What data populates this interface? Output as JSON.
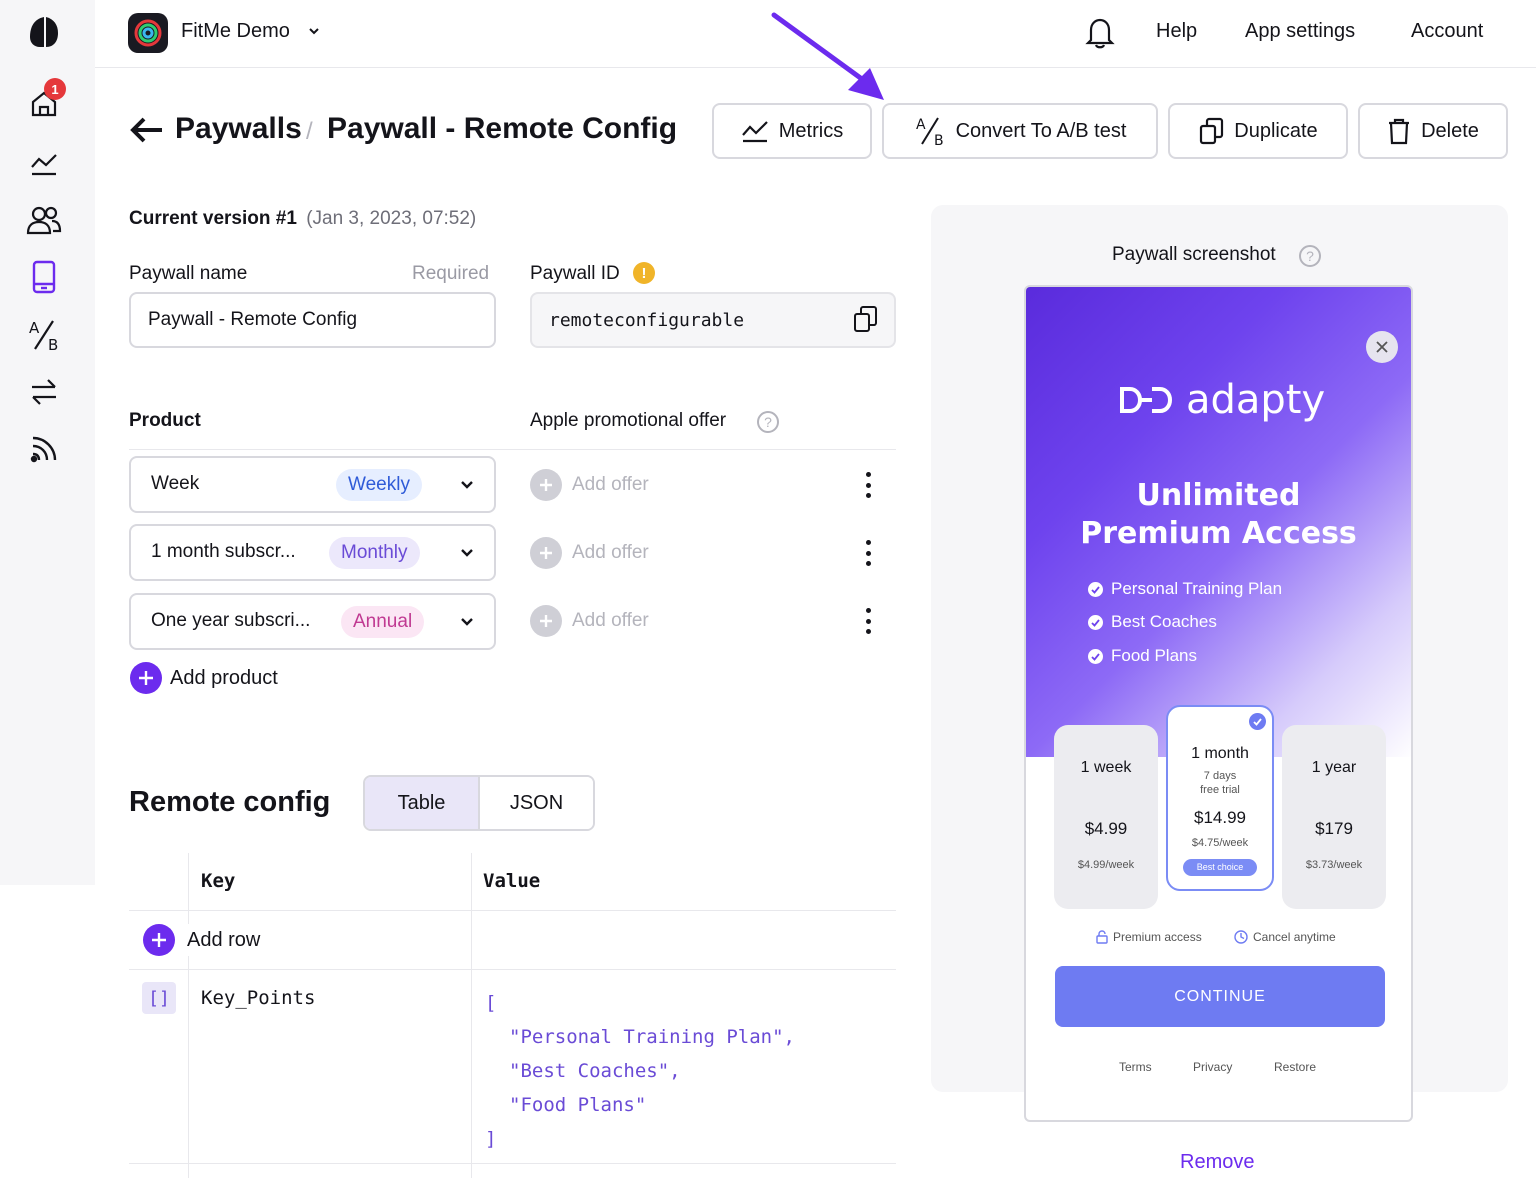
{
  "topbar": {
    "app_name": "FitMe Demo",
    "help": "Help",
    "app_settings": "App settings",
    "account": "Account"
  },
  "sidebar": {
    "home_badge": "1"
  },
  "header": {
    "crumb_parent": "Paywalls",
    "crumb_sep": "/",
    "crumb_current": "Paywall - Remote Config",
    "metrics": "Metrics",
    "convert": "Convert To A/B test",
    "duplicate": "Duplicate",
    "delete": "Delete"
  },
  "version": {
    "label": "Current version #1",
    "date": "(Jan 3, 2023, 07:52)"
  },
  "form": {
    "name_label": "Paywall name",
    "name_required": "Required",
    "name_value": "Paywall - Remote Config",
    "id_label": "Paywall ID",
    "id_value": "remoteconfigurable"
  },
  "products": {
    "product_header": "Product",
    "offer_header": "Apple promotional offer",
    "rows": [
      {
        "name": "Week",
        "period": "Weekly",
        "offer": "Add offer"
      },
      {
        "name": "1 month subscr...",
        "period": "Monthly",
        "offer": "Add offer"
      },
      {
        "name": "One year subscri...",
        "period": "Annual",
        "offer": "Add offer"
      }
    ],
    "add_product": "Add product"
  },
  "remote_config": {
    "title": "Remote config",
    "tab_table": "Table",
    "tab_json": "JSON",
    "col_key": "Key",
    "col_value": "Value",
    "add_row": "Add row",
    "row_type_badge": "[]",
    "row_key": "Key_Points",
    "value_lines": [
      "[",
      "\"Personal Training Plan\",",
      "\"Best Coaches\",",
      "\"Food Plans\"",
      "]"
    ]
  },
  "preview": {
    "title": "Paywall screenshot",
    "remove": "Remove",
    "brand": "adapty",
    "headline_1": "Unlimited",
    "headline_2": "Premium Access",
    "features": [
      "Personal Training Plan",
      "Best Coaches",
      "Food Plans"
    ],
    "plans": [
      {
        "title": "1 week",
        "price": "$4.99",
        "per": "$4.99/week"
      },
      {
        "title": "1 month",
        "trial_1": "7 days",
        "trial_2": "free trial",
        "price": "$14.99",
        "per": "$4.75/week",
        "badge": "Best choice"
      },
      {
        "title": "1 year",
        "price": "$179",
        "per": "$3.73/week"
      }
    ],
    "premium_access": "Premium access",
    "cancel_anytime": "Cancel anytime",
    "continue": "CONTINUE",
    "terms": "Terms",
    "privacy": "Privacy",
    "restore": "Restore"
  },
  "colors": {
    "accent": "#6c2bee",
    "weekly_pill": "#e6eeff",
    "monthly_pill": "#ece8fb",
    "annual_pill": "#fbe6f4",
    "continue_btn": "#6e7bf2"
  }
}
